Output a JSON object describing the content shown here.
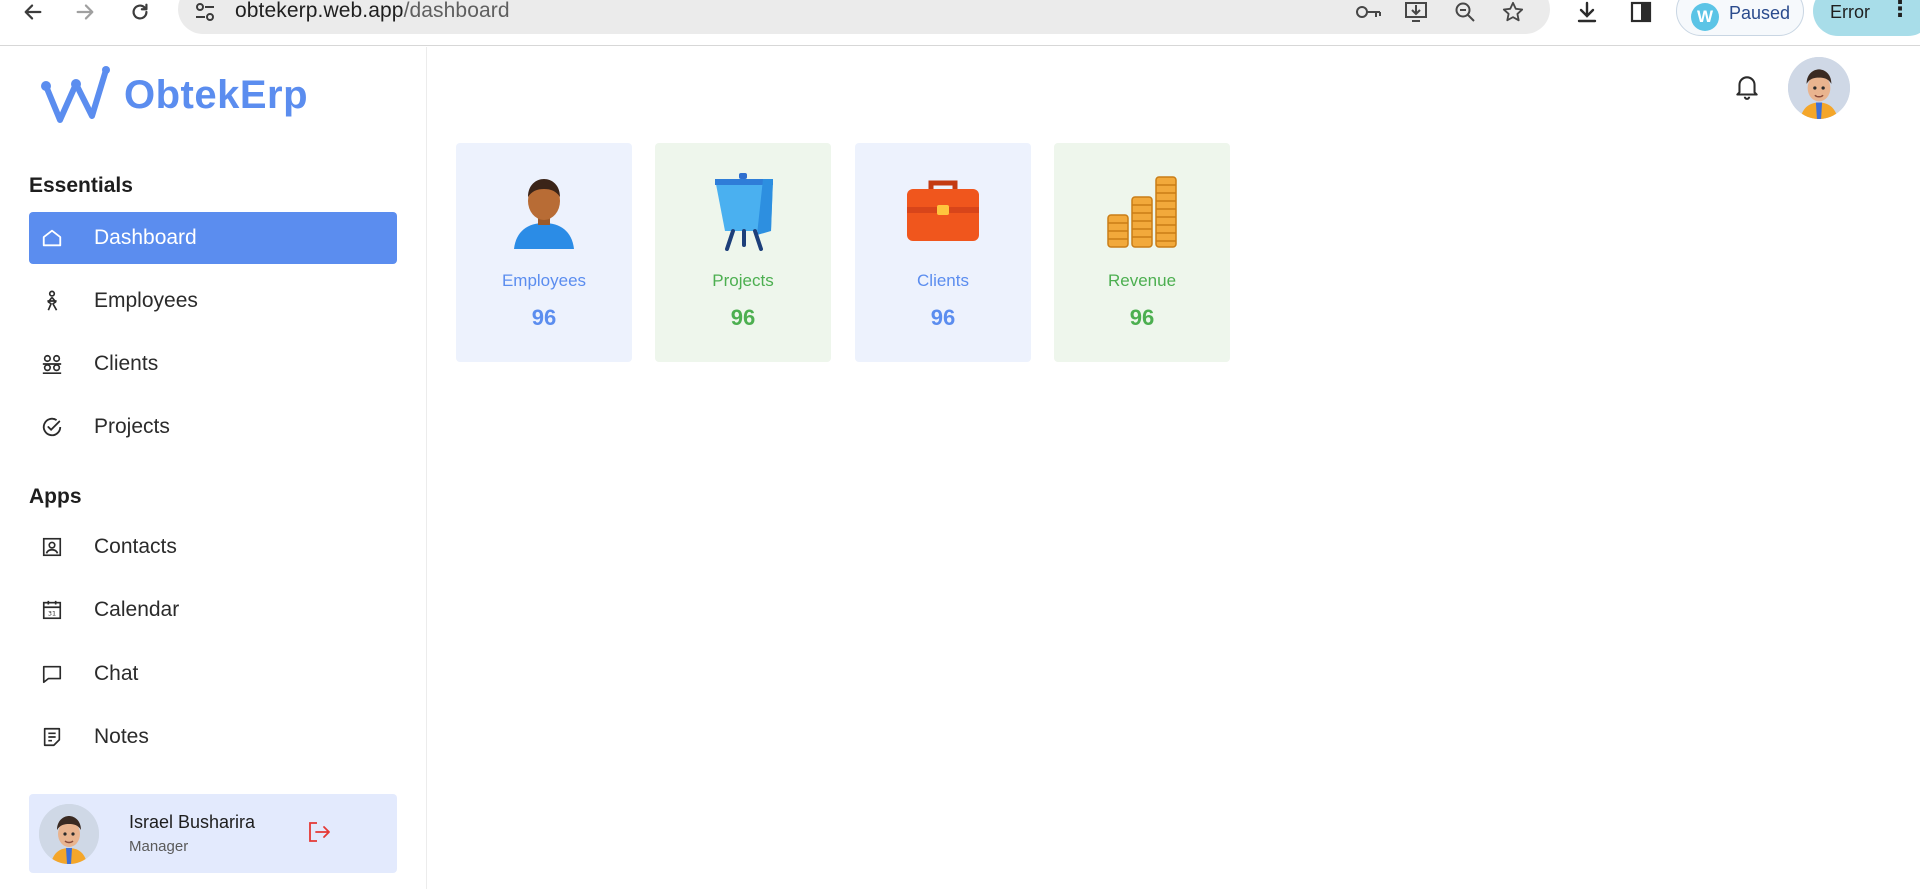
{
  "browser": {
    "url_host": "obtekerp.web.app",
    "url_path": "/dashboard",
    "profile_initial": "W",
    "profile_status": "Paused",
    "error_label": "Error"
  },
  "app": {
    "brand": "ObtekErp",
    "accent_color": "#5b8def",
    "success_color": "#4caf50"
  },
  "sidebar": {
    "sections": [
      {
        "title": "Essentials",
        "items": [
          {
            "label": "Dashboard",
            "icon": "home-icon",
            "active": true
          },
          {
            "label": "Employees",
            "icon": "person-walking-icon"
          },
          {
            "label": "Clients",
            "icon": "users-group-icon"
          },
          {
            "label": "Projects",
            "icon": "check-circle-icon"
          }
        ]
      },
      {
        "title": "Apps",
        "items": [
          {
            "label": "Contacts",
            "icon": "contact-card-icon"
          },
          {
            "label": "Calendar",
            "icon": "calendar-icon"
          },
          {
            "label": "Chat",
            "icon": "chat-bubble-icon"
          },
          {
            "label": "Notes",
            "icon": "notes-icon"
          }
        ]
      }
    ],
    "user": {
      "name": "Israel Busharira",
      "role": "Manager"
    }
  },
  "stats": [
    {
      "label": "Employees",
      "value": "96",
      "icon": "person-icon",
      "theme": "blue"
    },
    {
      "label": "Projects",
      "value": "96",
      "icon": "presentation-board-icon",
      "theme": "green"
    },
    {
      "label": "Clients",
      "value": "96",
      "icon": "briefcase-icon",
      "theme": "blue"
    },
    {
      "label": "Revenue",
      "value": "96",
      "icon": "coins-stack-icon",
      "theme": "green"
    }
  ]
}
